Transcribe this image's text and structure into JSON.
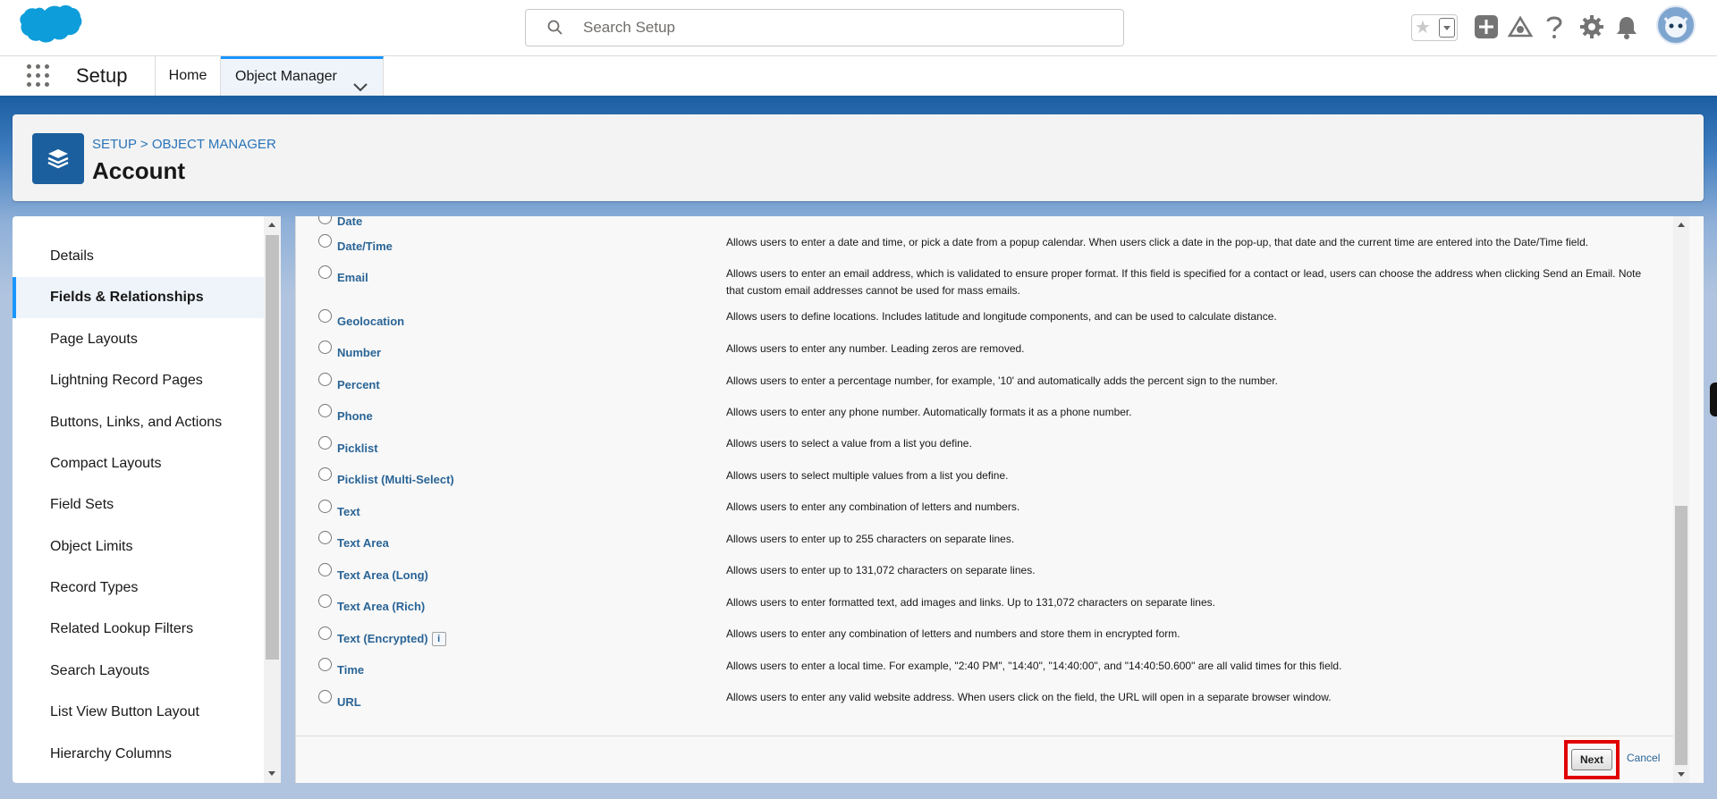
{
  "topbar": {
    "search_placeholder": "Search Setup",
    "icons": [
      "cloud-logo-icon",
      "search-icon",
      "favorites-star-icon",
      "favorites-dropdown-icon",
      "global-actions-add-icon",
      "trailhead-icon",
      "help-icon",
      "setup-gear-icon",
      "notifications-bell-icon",
      "user-avatar-icon"
    ]
  },
  "nav": {
    "app_name": "Setup",
    "tabs": [
      {
        "label": "Home"
      },
      {
        "label": "Object Manager"
      }
    ]
  },
  "header": {
    "breadcrumb": [
      "SETUP",
      "OBJECT MANAGER"
    ],
    "breadcrumb_sep": ">",
    "title": "Account"
  },
  "sidebar": {
    "items": [
      {
        "label": "Details"
      },
      {
        "label": "Fields & Relationships",
        "active": true
      },
      {
        "label": "Page Layouts"
      },
      {
        "label": "Lightning Record Pages"
      },
      {
        "label": "Buttons, Links, and Actions"
      },
      {
        "label": "Compact Layouts"
      },
      {
        "label": "Field Sets"
      },
      {
        "label": "Object Limits"
      },
      {
        "label": "Record Types"
      },
      {
        "label": "Related Lookup Filters"
      },
      {
        "label": "Search Layouts"
      },
      {
        "label": "List View Button Layout"
      },
      {
        "label": "Hierarchy Columns"
      }
    ]
  },
  "field_types": [
    {
      "name": "Date",
      "desc": ""
    },
    {
      "name": "Date/Time",
      "desc": "Allows users to enter a date and time, or pick a date from a popup calendar. When users click a date in the pop-up, that date and the current time are entered into the Date/Time field."
    },
    {
      "name": "Email",
      "desc": "Allows users to enter an email address, which is validated to ensure proper format. If this field is specified for a contact or lead, users can choose the address when clicking Send an Email. Note that custom email addresses cannot be used for mass emails."
    },
    {
      "name": "Geolocation",
      "desc": "Allows users to define locations. Includes latitude and longitude components, and can be used to calculate distance."
    },
    {
      "name": "Number",
      "desc": "Allows users to enter any number. Leading zeros are removed."
    },
    {
      "name": "Percent",
      "desc": "Allows users to enter a percentage number, for example, '10' and automatically adds the percent sign to the number."
    },
    {
      "name": "Phone",
      "desc": "Allows users to enter any phone number. Automatically formats it as a phone number."
    },
    {
      "name": "Picklist",
      "desc": "Allows users to select a value from a list you define."
    },
    {
      "name": "Picklist (Multi-Select)",
      "desc": "Allows users to select multiple values from a list you define."
    },
    {
      "name": "Text",
      "desc": "Allows users to enter any combination of letters and numbers."
    },
    {
      "name": "Text Area",
      "desc": "Allows users to enter up to 255 characters on separate lines."
    },
    {
      "name": "Text Area (Long)",
      "desc": "Allows users to enter up to 131,072 characters on separate lines."
    },
    {
      "name": "Text Area (Rich)",
      "desc": "Allows users to enter formatted text, add images and links. Up to 131,072 characters on separate lines."
    },
    {
      "name": "Text (Encrypted)",
      "desc": "Allows users to enter any combination of letters and numbers and store them in encrypted form.",
      "info_icon": "i"
    },
    {
      "name": "Time",
      "desc": "Allows users to enter a local time. For example, \"2:40 PM\", \"14:40\", \"14:40:00\", and \"14:40:50.600\" are all valid times for this field."
    },
    {
      "name": "URL",
      "desc": "Allows users to enter any valid website address. When users click on the field, the URL will open in a separate browser window."
    }
  ],
  "footer": {
    "next_label": "Next",
    "cancel_label": "Cancel"
  },
  "colors": {
    "link": "#2a6496",
    "brand_blue": "#1b5f9e",
    "highlight": "#e00000"
  }
}
